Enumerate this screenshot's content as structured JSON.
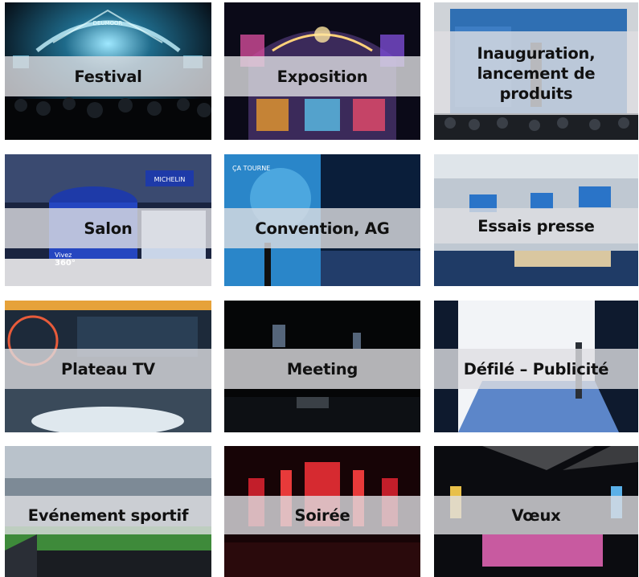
{
  "tiles": [
    {
      "label": "Festival"
    },
    {
      "label": "Exposition"
    },
    {
      "label": "Inauguration,\nlancement de\nproduits"
    },
    {
      "label": "Salon"
    },
    {
      "label": "Convention, AG"
    },
    {
      "label": "Essais presse"
    },
    {
      "label": "Plateau TV"
    },
    {
      "label": "Meeting"
    },
    {
      "label": "Défilé –  Publicité"
    },
    {
      "label": "Evénement sportif"
    },
    {
      "label": "Soirée"
    },
    {
      "label": "Vœux"
    }
  ],
  "embedded_text": {
    "festival_banner": "DEUMOOR",
    "salon_brand": "MICHELIN",
    "salon_slogan_1": "Vivez",
    "salon_slogan_2": "360°",
    "convention_backdrop": "ÇA TOURNE"
  }
}
